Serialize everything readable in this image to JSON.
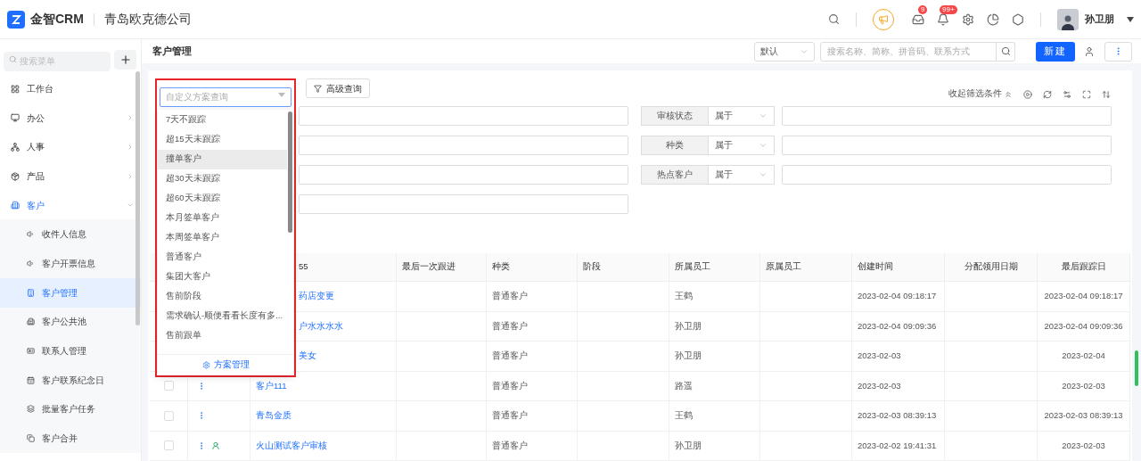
{
  "header": {
    "brand": "金智CRM",
    "company": "青岛欧克德公司",
    "badges": [
      "9",
      "99+"
    ],
    "user": "孙卫朋"
  },
  "sidebar": {
    "search_placeholder": "搜索菜单",
    "items": [
      {
        "label": "工作台",
        "selected": false
      },
      {
        "label": "办公",
        "selected": false,
        "expanded": false
      },
      {
        "label": "人事",
        "selected": false,
        "expanded": false
      },
      {
        "label": "产品",
        "selected": false,
        "expanded": false
      },
      {
        "label": "客户",
        "selected": true,
        "expanded": true,
        "children": [
          {
            "label": "收件人信息",
            "selected": false
          },
          {
            "label": "客户开票信息",
            "selected": false
          },
          {
            "label": "客户管理",
            "selected": true
          },
          {
            "label": "客户公共池",
            "selected": false
          },
          {
            "label": "联系人管理",
            "selected": false
          },
          {
            "label": "客户联系纪念日",
            "selected": false
          },
          {
            "label": "批量客户任务",
            "selected": false
          },
          {
            "label": "客户合并",
            "selected": false
          }
        ]
      }
    ]
  },
  "page": {
    "title": "客户管理",
    "view_select": "默认",
    "search_placeholder": "搜索名称、简称、拼音码、联系方式",
    "new_button": "新建"
  },
  "filters": {
    "advanced_button": "高级查询",
    "collapse_link": "收起筛选条件",
    "conditions": [
      {
        "label": "审核状态",
        "operator": "属于"
      },
      {
        "label": "种类",
        "operator": "属于"
      },
      {
        "label": "热点客户",
        "operator": "属于"
      }
    ]
  },
  "scheme_dropdown": {
    "placeholder": "自定义方案查询",
    "items": [
      {
        "label": "7天不跟踪",
        "hovered": false
      },
      {
        "label": "超15天未跟踪",
        "hovered": false
      },
      {
        "label": "撞单客户",
        "hovered": true
      },
      {
        "label": "超30天未跟踪",
        "hovered": false
      },
      {
        "label": "超60天未跟踪",
        "hovered": false
      },
      {
        "label": "本月签单客户",
        "hovered": false
      },
      {
        "label": "本周签单客户",
        "hovered": false
      },
      {
        "label": "普通客户",
        "hovered": false
      },
      {
        "label": "集团大客户",
        "hovered": false
      },
      {
        "label": "售前阶段",
        "hovered": false
      },
      {
        "label": "需求确认-顺便看看长度有多...",
        "hovered": false
      },
      {
        "label": "售前跟单",
        "hovered": false
      }
    ],
    "footer": "方案管理"
  },
  "table": {
    "columns": [
      "55",
      "最后一次跟进",
      "种类",
      "阶段",
      "所属员工",
      "原属员工",
      "创建时间",
      "分配领用日期",
      "最后跟踪日"
    ],
    "rows": [
      {
        "name": "药店变更",
        "category": "普通客户",
        "employee": "王鹤",
        "created": "2023-02-04 09:18:17",
        "last_tracked": "2023-02-04 09:18:17"
      },
      {
        "name": "户水水水水",
        "category": "普通客户",
        "employee": "孙卫朋",
        "created": "2023-02-04 09:09:36",
        "last_tracked": "2023-02-04 09:09:36"
      },
      {
        "name": "美女",
        "category": "普通客户",
        "employee": "孙卫朋",
        "created": "2023-02-03",
        "last_tracked": "2023-02-04"
      },
      {
        "name": "客户111",
        "checked": false,
        "person_tag": false,
        "category": "普通客户",
        "employee": "路遥",
        "created": "2023-02-03",
        "last_tracked": "2023-02-03"
      },
      {
        "name": "青岛金质",
        "checked": false,
        "person_tag": false,
        "category": "普通客户",
        "employee": "王鹤",
        "created": "2023-02-03 08:39:13",
        "last_tracked": "2023-02-03 08:39:13"
      },
      {
        "name": "火山测试客户审核",
        "checked": false,
        "person_tag": true,
        "category": "普通客户",
        "employee": "孙卫朋",
        "created": "2023-02-02 19:41:31",
        "last_tracked": "2023-02-03"
      }
    ]
  }
}
